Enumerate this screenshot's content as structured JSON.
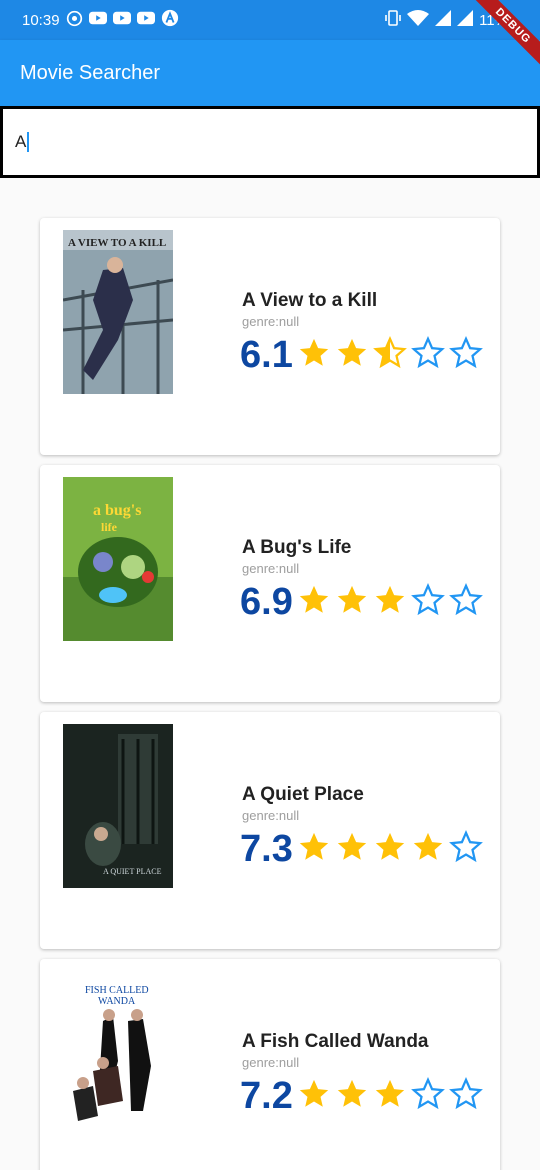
{
  "status": {
    "time": "10:39",
    "battery": "11%"
  },
  "debug_label": "DEBUG",
  "app": {
    "title": "Movie Searcher"
  },
  "search": {
    "value": "A"
  },
  "colors": {
    "primary": "#2196f3",
    "score": "#0d47a1",
    "star_filled": "#ffc107",
    "star_outline": "#2196f3"
  },
  "movies": [
    {
      "title": "A View to a Kill",
      "genre": "genre:null",
      "rating": "6.1",
      "stars": [
        "full",
        "full",
        "half",
        "empty",
        "empty"
      ],
      "poster_text": "A VIEW TO A KILL"
    },
    {
      "title": "A Bug's Life",
      "genre": "genre:null",
      "rating": "6.9",
      "stars": [
        "full",
        "full",
        "full",
        "empty",
        "empty"
      ],
      "poster_text": "a bug's life"
    },
    {
      "title": "A Quiet Place",
      "genre": "genre:null",
      "rating": "7.3",
      "stars": [
        "full",
        "full",
        "full",
        "full",
        "empty"
      ],
      "poster_text": "A QUIET PLACE"
    },
    {
      "title": "A Fish Called Wanda",
      "genre": "genre:null",
      "rating": "7.2",
      "stars": [
        "full",
        "full",
        "full",
        "empty",
        "empty"
      ],
      "poster_text": "FISH CALLED WANDA"
    }
  ]
}
